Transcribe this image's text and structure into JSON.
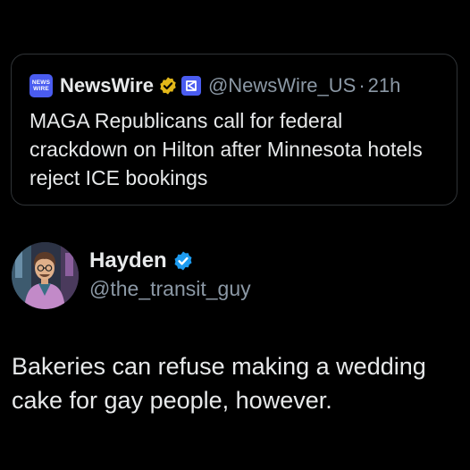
{
  "quoted_tweet": {
    "logo_text_top": "NEWS",
    "logo_text_bottom": "WIRE",
    "display_name": "NewsWire",
    "handle": "@NewsWire_US",
    "separator": "·",
    "time": "21h",
    "text": "MAGA Republicans call for federal crackdown on Hilton after Minnesota hotels reject ICE bookings",
    "badge_icon": "gold-verified-icon",
    "affiliate_icon": "affiliate-badge-icon"
  },
  "tweet": {
    "display_name": "Hayden",
    "handle": "@the_transit_guy",
    "text": "Bakeries can refuse making a wedding cake for gay people, however.",
    "badge_icon": "blue-verified-icon"
  },
  "colors": {
    "background": "#000000",
    "text_primary": "#e7e9ea",
    "text_secondary": "#8b98a5",
    "border": "#2f3336",
    "brand_newswire": "#4a5cf0",
    "verified_gold": "#e2b719",
    "verified_blue": "#1d9bf0"
  }
}
